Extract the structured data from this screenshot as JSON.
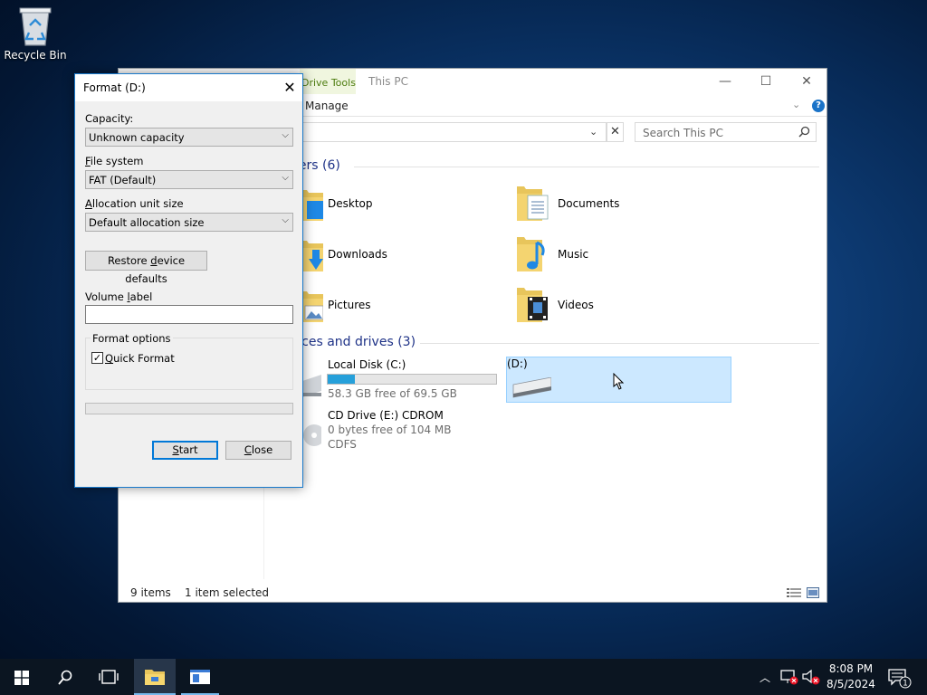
{
  "desktop": {
    "recycle_bin_label": "Recycle Bin"
  },
  "explorer": {
    "context_tab_label": "Drive Tools",
    "manage_tab_label": "Manage",
    "window_title": "This PC",
    "search_placeholder": "Search This PC",
    "folders_header": "ders (6)",
    "drives_header": "vices and drives (3)",
    "folders": [
      {
        "name": "Desktop",
        "icon": "desktop-folder-icon"
      },
      {
        "name": "Documents",
        "icon": "documents-folder-icon"
      },
      {
        "name": "Downloads",
        "icon": "downloads-folder-icon"
      },
      {
        "name": "Music",
        "icon": "music-folder-icon"
      },
      {
        "name": "Pictures",
        "icon": "pictures-folder-icon"
      },
      {
        "name": "Videos",
        "icon": "videos-folder-icon"
      }
    ],
    "drives": [
      {
        "name": "Local Disk (C:)",
        "free_text": "58.3 GB free of 69.5 GB",
        "used_fraction": 0.16
      },
      {
        "name": "(D:)",
        "selected": true
      },
      {
        "name": "CD Drive (E:) CDROM",
        "free_text": "0 bytes free of 104 MB",
        "fs_text": "CDFS"
      }
    ],
    "status": {
      "items": "9 items",
      "selected": "1 item selected"
    }
  },
  "format_dialog": {
    "title": "Format  (D:)",
    "capacity_label": "Capacity:",
    "capacity_value": "Unknown capacity",
    "fs_label_pre": "",
    "fs_label_u": "F",
    "fs_label_post": "ile system",
    "fs_value": "FAT (Default)",
    "alloc_label_u": "A",
    "alloc_label_post": "llocation unit size",
    "alloc_value": "Default allocation size",
    "restore_pre": "Restore ",
    "restore_u": "d",
    "restore_post": "evice defaults",
    "volume_pre": "Volume ",
    "volume_u": "l",
    "volume_post": "abel",
    "volume_value": "",
    "format_options_label": "Format options",
    "quick_format_u": "Q",
    "quick_format_post": "uick Format",
    "quick_format_checked": true,
    "progress_fraction": 0,
    "start_u": "S",
    "start_post": "tart",
    "close_u": "C",
    "close_post": "lose"
  },
  "taskbar": {
    "time": "8:08 PM",
    "date": "8/5/2024",
    "notification_count": "1"
  }
}
